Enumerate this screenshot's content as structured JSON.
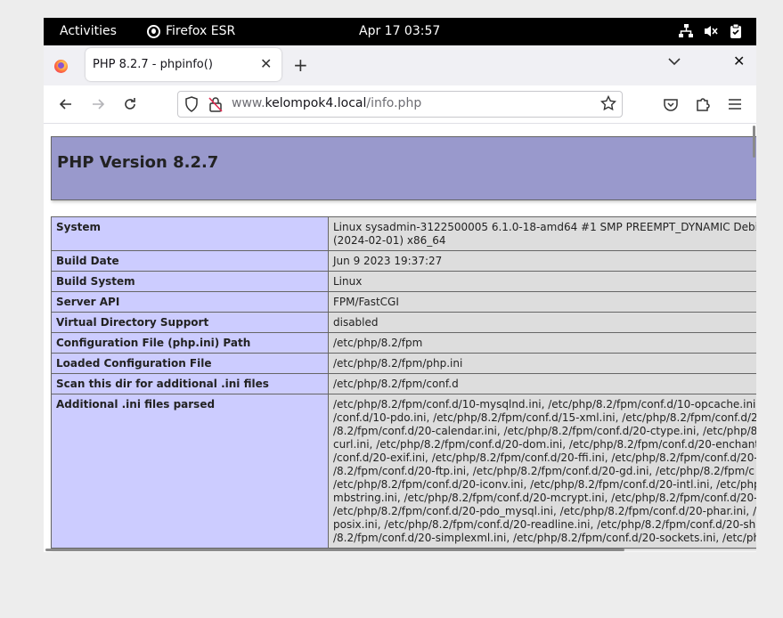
{
  "topbar": {
    "activities": "Activities",
    "app_name": "Firefox ESR",
    "clock": "Apr 17  03:57",
    "tray_icons": [
      "network-icon",
      "volume-muted-icon",
      "clipboard-icon"
    ]
  },
  "tabs": [
    {
      "title": "PHP 8.2.7 - phpinfo()",
      "active": true
    }
  ],
  "navbar": {
    "url_prefix": "www.",
    "url_host": "kelompok4.local",
    "url_path": "/info.php"
  },
  "page": {
    "heading": "PHP Version 8.2.7",
    "header_bg": "#9999cc",
    "key_bg": "#ccccff",
    "value_bg": "#dddddd",
    "rows": [
      {
        "key": "System",
        "value": [
          "Linux sysadmin-3122500005 6.1.0-18-amd64 #1 SMP PREEMPT_DYNAMIC Debi",
          "(2024-02-01) x86_64"
        ]
      },
      {
        "key": "Build Date",
        "value": [
          "Jun 9 2023 19:37:27"
        ]
      },
      {
        "key": "Build System",
        "value": [
          "Linux"
        ]
      },
      {
        "key": "Server API",
        "value": [
          "FPM/FastCGI"
        ]
      },
      {
        "key": "Virtual Directory Support",
        "value": [
          "disabled"
        ]
      },
      {
        "key": "Configuration File (php.ini) Path",
        "value": [
          "/etc/php/8.2/fpm"
        ]
      },
      {
        "key": "Loaded Configuration File",
        "value": [
          "/etc/php/8.2/fpm/php.ini"
        ]
      },
      {
        "key": "Scan this dir for additional .ini files",
        "value": [
          "/etc/php/8.2/fpm/conf.d"
        ]
      },
      {
        "key": "Additional .ini files parsed",
        "value": [
          "/etc/php/8.2/fpm/conf.d/10-mysqlnd.ini, /etc/php/8.2/fpm/conf.d/10-opcache.ini",
          "/conf.d/10-pdo.ini, /etc/php/8.2/fpm/conf.d/15-xml.ini, /etc/php/8.2/fpm/conf.d/2",
          "/8.2/fpm/conf.d/20-calendar.ini, /etc/php/8.2/fpm/conf.d/20-ctype.ini, /etc/php/8",
          "curl.ini, /etc/php/8.2/fpm/conf.d/20-dom.ini, /etc/php/8.2/fpm/conf.d/20-enchant",
          "/conf.d/20-exif.ini, /etc/php/8.2/fpm/conf.d/20-ffi.ini, /etc/php/8.2/fpm/conf.d/20-",
          "/8.2/fpm/conf.d/20-ftp.ini, /etc/php/8.2/fpm/conf.d/20-gd.ini, /etc/php/8.2/fpm/c",
          "/etc/php/8.2/fpm/conf.d/20-iconv.ini, /etc/php/8.2/fpm/conf.d/20-intl.ini, /etc/php",
          "mbstring.ini, /etc/php/8.2/fpm/conf.d/20-mcrypt.ini, /etc/php/8.2/fpm/conf.d/20-",
          "/etc/php/8.2/fpm/conf.d/20-pdo_mysql.ini, /etc/php/8.2/fpm/conf.d/20-phar.ini, /etc/php/",
          "posix.ini, /etc/php/8.2/fpm/conf.d/20-readline.ini, /etc/php/8.2/fpm/conf.d/20-sh",
          "/8.2/fpm/conf.d/20-simplexml.ini, /etc/php/8.2/fpm/conf.d/20-sockets.ini, /etc/ph"
        ]
      }
    ]
  }
}
